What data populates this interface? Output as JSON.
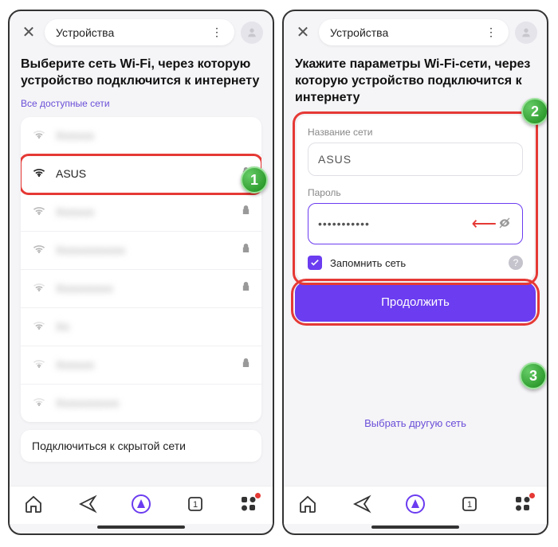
{
  "header": {
    "title": "Устройства"
  },
  "left": {
    "heading": "Выберите сеть Wi-Fi, через которую устройство подключится к интернету",
    "all_networks": "Все доступные сети",
    "networks": [
      {
        "name": "Xxxxxx",
        "strength": 2,
        "locked": false,
        "blur": true
      },
      {
        "name": "ASUS",
        "strength": 4,
        "locked": true,
        "blur": false,
        "highlight": true
      },
      {
        "name": "Xxxxxx",
        "strength": 3,
        "locked": true,
        "blur": true
      },
      {
        "name": "Xxxxxxxxxxx",
        "strength": 3,
        "locked": true,
        "blur": true
      },
      {
        "name": "Xxxxxxxxx",
        "strength": 2,
        "locked": true,
        "blur": true
      },
      {
        "name": "Xx",
        "strength": 2,
        "locked": false,
        "blur": true
      },
      {
        "name": "Xxxxxx",
        "strength": 1,
        "locked": true,
        "blur": true
      },
      {
        "name": "Xxxxxxxxxx",
        "strength": 1,
        "locked": false,
        "blur": true
      }
    ],
    "hidden_link": "Подключиться к скрытой сети"
  },
  "right": {
    "heading": "Укажите параметры Wi-Fi-сети, через которую устройство подключится к интернету",
    "name_label": "Название сети",
    "name_value": "ASUS",
    "password_label": "Пароль",
    "password_value": "•••••••••••",
    "remember": "Запомнить сеть",
    "continue": "Продолжить",
    "other": "Выбрать другую сеть"
  },
  "nav": {
    "tab_count": "1"
  },
  "badges": {
    "b1": "1",
    "b2": "2",
    "b3": "3"
  }
}
